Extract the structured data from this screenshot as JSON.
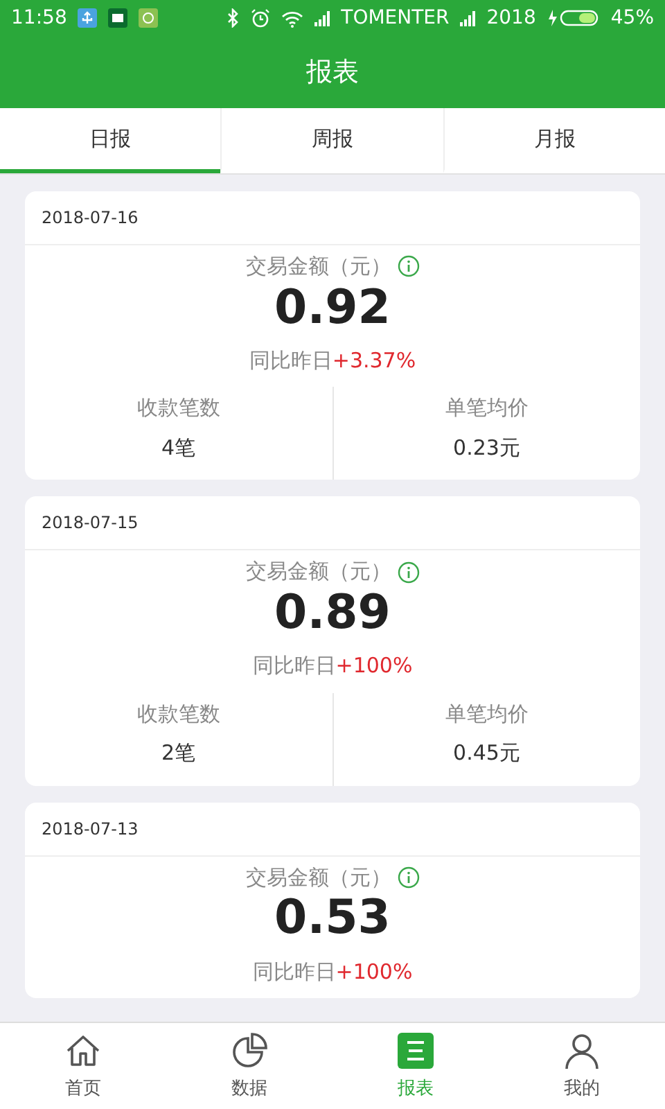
{
  "status_bar": {
    "time": "11:58",
    "carrier": "TOMENTER",
    "network": "2018",
    "battery": "45%"
  },
  "header": {
    "title": "报表"
  },
  "tabs": [
    {
      "label": "日报",
      "selected": true
    },
    {
      "label": "周报",
      "selected": false
    },
    {
      "label": "月报",
      "selected": false
    }
  ],
  "reports": [
    {
      "date": "2018-07-16",
      "amount_label": "交易金额（元）",
      "amount": "0.92",
      "compare_label": "同比昨日",
      "compare_value": "+3.37%",
      "stats": [
        {
          "label": "收款笔数",
          "value": "4笔"
        },
        {
          "label": "单笔均价",
          "value": "0.23元"
        }
      ]
    },
    {
      "date": "2018-07-15",
      "amount_label": "交易金额（元）",
      "amount": "0.89",
      "compare_label": "同比昨日",
      "compare_value": "+100%",
      "stats": [
        {
          "label": "收款笔数",
          "value": "2笔"
        },
        {
          "label": "单笔均价",
          "value": "0.45元"
        }
      ]
    },
    {
      "date": "2018-07-13",
      "amount_label": "交易金额（元）",
      "amount": "0.53",
      "compare_label": "同比昨日",
      "compare_value": "+100%"
    }
  ],
  "bottom_nav": [
    {
      "label": "首页",
      "kind": "home",
      "selected": false
    },
    {
      "label": "数据",
      "kind": "chart",
      "selected": false
    },
    {
      "label": "报表",
      "kind": "report",
      "selected": true
    },
    {
      "label": "我的",
      "kind": "user",
      "selected": false
    }
  ]
}
